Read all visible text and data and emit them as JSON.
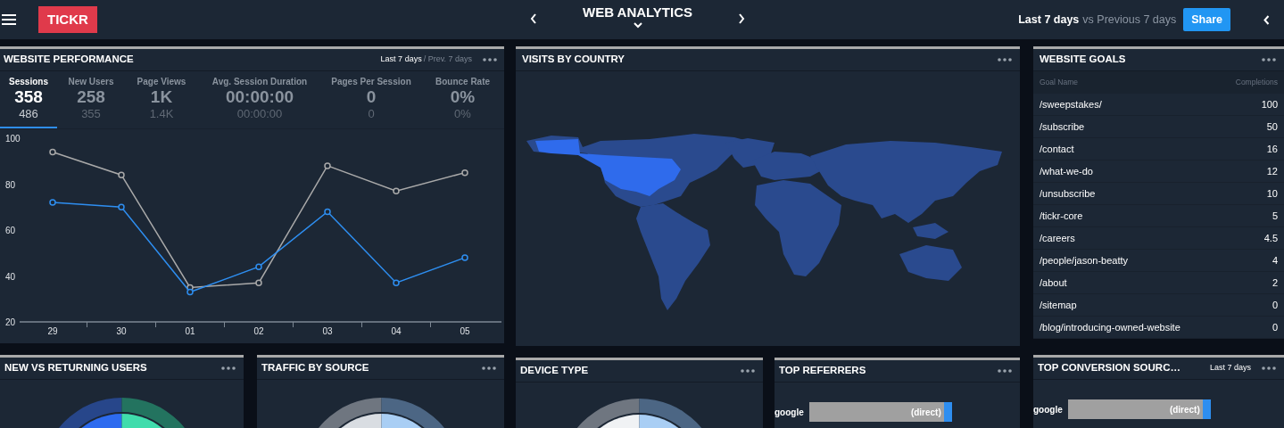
{
  "header": {
    "logo": "TICKR",
    "title": "WEB ANALYTICS",
    "date_range": "Last 7 days",
    "comparison": "vs Previous 7 days",
    "share_button": "Share"
  },
  "website_performance": {
    "title": "WEBSITE PERFORMANCE",
    "range": "Last 7 days",
    "range_compare": "/ Prev. 7 days",
    "metrics": [
      {
        "label": "Sessions",
        "value": "358",
        "previous": "486",
        "selected": true
      },
      {
        "label": "New Users",
        "value": "258",
        "previous": "355",
        "selected": false
      },
      {
        "label": "Page Views",
        "value": "1K",
        "previous": "1.4K",
        "selected": false
      },
      {
        "label": "Avg. Session Duration",
        "value": "00:00:00",
        "previous": "00:00:00",
        "selected": false
      },
      {
        "label": "Pages Per Session",
        "value": "0",
        "previous": "0",
        "selected": false
      },
      {
        "label": "Bounce Rate",
        "value": "0%",
        "previous": "0%",
        "selected": false
      }
    ],
    "chart_data": {
      "type": "line",
      "categories": [
        "29",
        "30",
        "01",
        "02",
        "03",
        "04",
        "05"
      ],
      "yticks": [
        20,
        40,
        60,
        80,
        100
      ],
      "ylim": [
        20,
        100
      ],
      "series": [
        {
          "color": "#a9a9a9",
          "marker": true,
          "values": [
            94,
            84,
            35,
            37,
            88,
            77,
            85
          ]
        },
        {
          "color": "#2e8ef0",
          "marker": true,
          "values": [
            72,
            70,
            33,
            44,
            68,
            37,
            48
          ]
        }
      ]
    }
  },
  "visits_by_country": {
    "title": "VISITS BY COUNTRY"
  },
  "website_goals": {
    "title": "WEBSITE GOALS",
    "columns": [
      "Goal Name",
      "Completions"
    ],
    "rows": [
      {
        "goal": "/sweepstakes/",
        "completions": "100"
      },
      {
        "goal": "/subscribe",
        "completions": "50"
      },
      {
        "goal": "/contact",
        "completions": "16"
      },
      {
        "goal": "/what-we-do",
        "completions": "12"
      },
      {
        "goal": "/unsubscribe",
        "completions": "10"
      },
      {
        "goal": "/tickr-core",
        "completions": "5"
      },
      {
        "goal": "/careers",
        "completions": "4.5"
      },
      {
        "goal": "/people/jason-beatty",
        "completions": "4"
      },
      {
        "goal": "/about",
        "completions": "2"
      },
      {
        "goal": "/sitemap",
        "completions": "0"
      },
      {
        "goal": "/blog/introducing-owned-website",
        "completions": "0"
      }
    ]
  },
  "new_vs_returning_users": {
    "title": "NEW VS RETURNING USERS"
  },
  "traffic_by_source": {
    "title": "TRAFFIC BY SOURCE"
  },
  "device_type": {
    "title": "DEVICE TYPE"
  },
  "top_referrers": {
    "title": "TOP REFERRERS",
    "bars": [
      {
        "label": "google",
        "segment_label": "(direct)"
      }
    ]
  },
  "top_conversion_sources": {
    "title": "TOP CONVERSION SOURC…",
    "range": "Last 7 days",
    "bars": [
      {
        "label": "google",
        "segment_label": "(direct)"
      }
    ]
  }
}
